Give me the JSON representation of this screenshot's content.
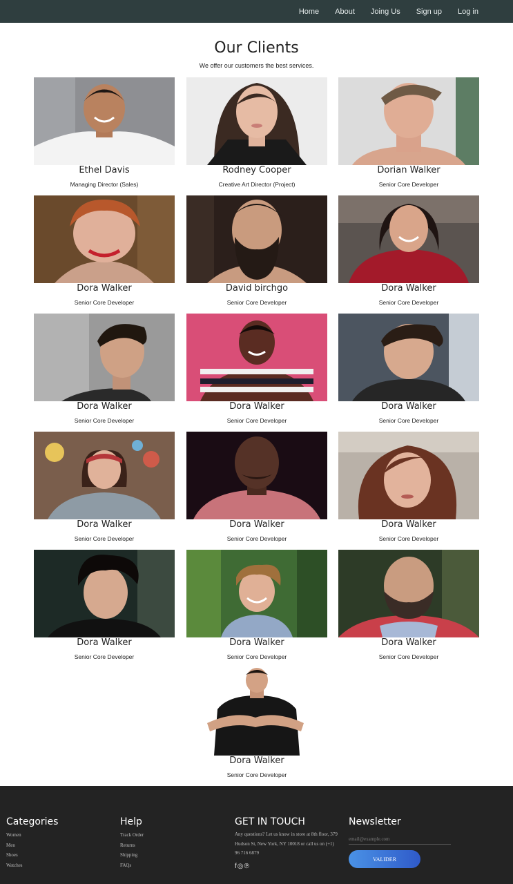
{
  "nav": {
    "links": [
      "Home",
      "About",
      "Joing Us",
      "Sign up",
      "Log in"
    ]
  },
  "clients": {
    "title": "Our Clients",
    "subtitle": "We offer our customers the best services.",
    "cards": [
      {
        "name": "Ethel Davis",
        "role": "Managing Director (Sales)"
      },
      {
        "name": "Rodney Cooper",
        "role": "Creative Art Director (Project)"
      },
      {
        "name": "Dorian Walker",
        "role": "Senior Core Developer"
      },
      {
        "name": "Dora Walker",
        "role": "Senior Core Developer"
      },
      {
        "name": "David birchgo",
        "role": "Senior Core Developer"
      },
      {
        "name": "Dora Walker",
        "role": "Senior Core Developer"
      },
      {
        "name": "Dora Walker",
        "role": "Senior Core Developer"
      },
      {
        "name": "Dora Walker",
        "role": "Senior Core Developer"
      },
      {
        "name": "Dora Walker",
        "role": "Senior Core Developer"
      },
      {
        "name": "Dora Walker",
        "role": "Senior Core Developer"
      },
      {
        "name": "Dora Walker",
        "role": "Senior Core Developer"
      },
      {
        "name": "Dora Walker",
        "role": "Senior Core Developer"
      },
      {
        "name": "Dora Walker",
        "role": "Senior Core Developer"
      },
      {
        "name": "Dora Walker",
        "role": "Senior Core Developer"
      },
      {
        "name": "Dora Walker",
        "role": "Senior Core Developer"
      },
      {
        "name": "Dora Walker",
        "role": "Senior Core Developer"
      }
    ]
  },
  "footer": {
    "categories": {
      "title": "Categories",
      "links": [
        "Women",
        "Men",
        "Shoes",
        "Watches"
      ]
    },
    "help": {
      "title": "Help",
      "links": [
        "Track Order",
        "Returns",
        "Shipping",
        "FAQs"
      ]
    },
    "contact": {
      "title": "GET IN TOUCH",
      "text": "Any questions? Let us know in store at 8th floor, 379 Hudson St, New York, NY 10018 or call us on (+1) 96 716 6879",
      "social_icons": [
        "facebook-icon",
        "instagram-icon",
        "pinterest-icon"
      ],
      "social_glyphs": [
        "f",
        "◎",
        "℗"
      ]
    },
    "newsletter": {
      "title": "Newsletter",
      "placeholder": "email@example.com",
      "button": "VALIDER"
    }
  },
  "colors": {
    "nav_bg": "#2f3e3f",
    "footer_bg": "#232323",
    "button_gradient_start": "#4a92e6",
    "button_gradient_end": "#2f5ac9"
  }
}
